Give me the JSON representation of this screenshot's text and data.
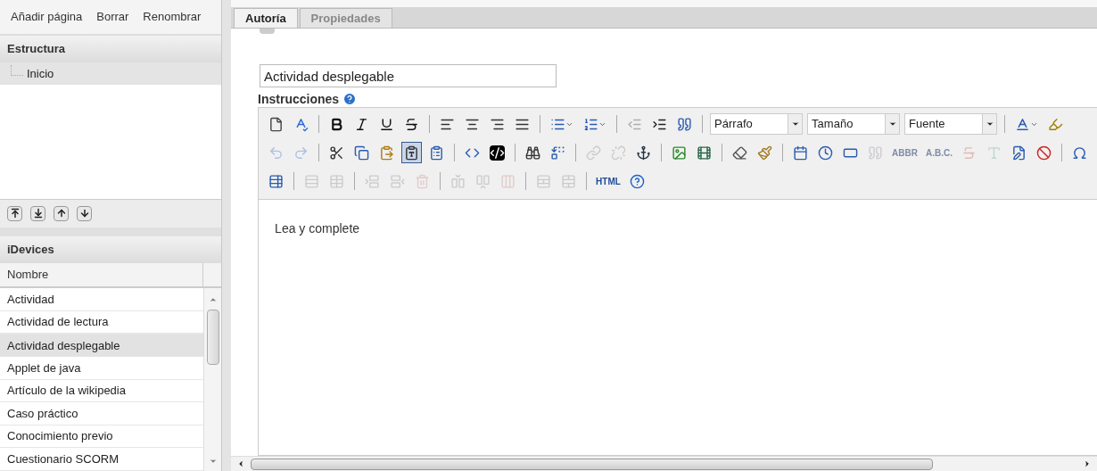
{
  "menu": [
    "Añadir página",
    "Borrar",
    "Renombrar"
  ],
  "structure": {
    "title": "Estructura",
    "tree": [
      {
        "label": "Inicio",
        "selected": true
      }
    ]
  },
  "idevices": {
    "title": "iDevices",
    "column": "Nombre",
    "rows": [
      {
        "label": "Actividad",
        "selected": false
      },
      {
        "label": "Actividad de lectura",
        "selected": false
      },
      {
        "label": "Actividad desplegable",
        "selected": true
      },
      {
        "label": "Applet de java",
        "selected": false
      },
      {
        "label": "Artículo de la wikipedia",
        "selected": false
      },
      {
        "label": "Caso práctico",
        "selected": false
      },
      {
        "label": "Conocimiento previo",
        "selected": false
      },
      {
        "label": "Cuestionario SCORM",
        "selected": false
      }
    ]
  },
  "tabs": [
    {
      "label": "Autoría",
      "selected": true
    },
    {
      "label": "Propiedades",
      "selected": false
    }
  ],
  "title_field": {
    "value": "Actividad desplegable"
  },
  "instructions_label": "Instrucciones",
  "toolbar": [
    [
      {
        "kind": "button",
        "disabled": false
      },
      {
        "kind": "button",
        "disabled": false
      },
      {
        "kind": "separator"
      },
      {
        "kind": "button",
        "disabled": false
      },
      {
        "kind": "button",
        "disabled": false
      },
      {
        "kind": "button",
        "disabled": false
      },
      {
        "kind": "button",
        "disabled": false
      },
      {
        "kind": "separator"
      },
      {
        "kind": "button",
        "disabled": false
      },
      {
        "kind": "button",
        "disabled": false
      },
      {
        "kind": "button",
        "disabled": false
      },
      {
        "kind": "button",
        "disabled": false
      },
      {
        "kind": "separator"
      },
      {
        "kind": "dropbutton",
        "disabled": false
      },
      {
        "kind": "dropbutton",
        "disabled": false
      },
      {
        "kind": "separator"
      },
      {
        "kind": "button",
        "disabled": true
      },
      {
        "kind": "button",
        "disabled": false
      },
      {
        "kind": "button",
        "disabled": false
      },
      {
        "kind": "separator"
      },
      {
        "kind": "select",
        "value": "Párrafo"
      },
      {
        "kind": "select",
        "value": "Tamaño"
      },
      {
        "kind": "select",
        "value": "Fuente"
      },
      {
        "kind": "separator"
      },
      {
        "kind": "dropbutton",
        "disabled": false
      },
      {
        "kind": "button",
        "disabled": false
      }
    ],
    [
      {
        "kind": "button",
        "disabled": true
      },
      {
        "kind": "button",
        "disabled": true
      },
      {
        "kind": "separator"
      },
      {
        "kind": "button",
        "disabled": false
      },
      {
        "kind": "button",
        "disabled": false
      },
      {
        "kind": "button",
        "disabled": false
      },
      {
        "kind": "button",
        "disabled": false,
        "selected": true
      },
      {
        "kind": "button",
        "disabled": false
      },
      {
        "kind": "separator"
      },
      {
        "kind": "button",
        "disabled": false
      },
      {
        "kind": "button",
        "disabled": false
      },
      {
        "kind": "separator"
      },
      {
        "kind": "button",
        "disabled": false
      },
      {
        "kind": "button",
        "disabled": false
      },
      {
        "kind": "separator"
      },
      {
        "kind": "button",
        "disabled": true
      },
      {
        "kind": "button",
        "disabled": true
      },
      {
        "kind": "button",
        "disabled": false
      },
      {
        "kind": "separator"
      },
      {
        "kind": "button",
        "disabled": false
      },
      {
        "kind": "button",
        "disabled": false
      },
      {
        "kind": "separator"
      },
      {
        "kind": "button",
        "disabled": false
      },
      {
        "kind": "button",
        "disabled": false
      },
      {
        "kind": "separator"
      },
      {
        "kind": "button",
        "disabled": false
      },
      {
        "kind": "button",
        "disabled": false
      },
      {
        "kind": "button",
        "disabled": false
      },
      {
        "kind": "button",
        "disabled": true
      },
      {
        "kind": "text",
        "text": "ABBR",
        "disabled": true
      },
      {
        "kind": "text",
        "text": "A.B.C.",
        "disabled": true
      },
      {
        "kind": "button",
        "disabled": true
      },
      {
        "kind": "button",
        "disabled": true
      },
      {
        "kind": "button",
        "disabled": false
      },
      {
        "kind": "button",
        "disabled": false
      },
      {
        "kind": "separator"
      },
      {
        "kind": "button",
        "disabled": false
      }
    ],
    [
      {
        "kind": "button",
        "disabled": false
      },
      {
        "kind": "separator"
      },
      {
        "kind": "button",
        "disabled": true
      },
      {
        "kind": "button",
        "disabled": true
      },
      {
        "kind": "separator"
      },
      {
        "kind": "button",
        "disabled": true
      },
      {
        "kind": "button",
        "disabled": true
      },
      {
        "kind": "button",
        "disabled": true
      },
      {
        "kind": "separator"
      },
      {
        "kind": "button",
        "disabled": true
      },
      {
        "kind": "button",
        "disabled": true
      },
      {
        "kind": "button",
        "disabled": true
      },
      {
        "kind": "separator"
      },
      {
        "kind": "button",
        "disabled": true
      },
      {
        "kind": "button",
        "disabled": true
      },
      {
        "kind": "separator"
      },
      {
        "kind": "text",
        "text": "HTML",
        "disabled": false
      },
      {
        "kind": "button",
        "disabled": false
      }
    ]
  ],
  "editor_text": "Lea y complete"
}
